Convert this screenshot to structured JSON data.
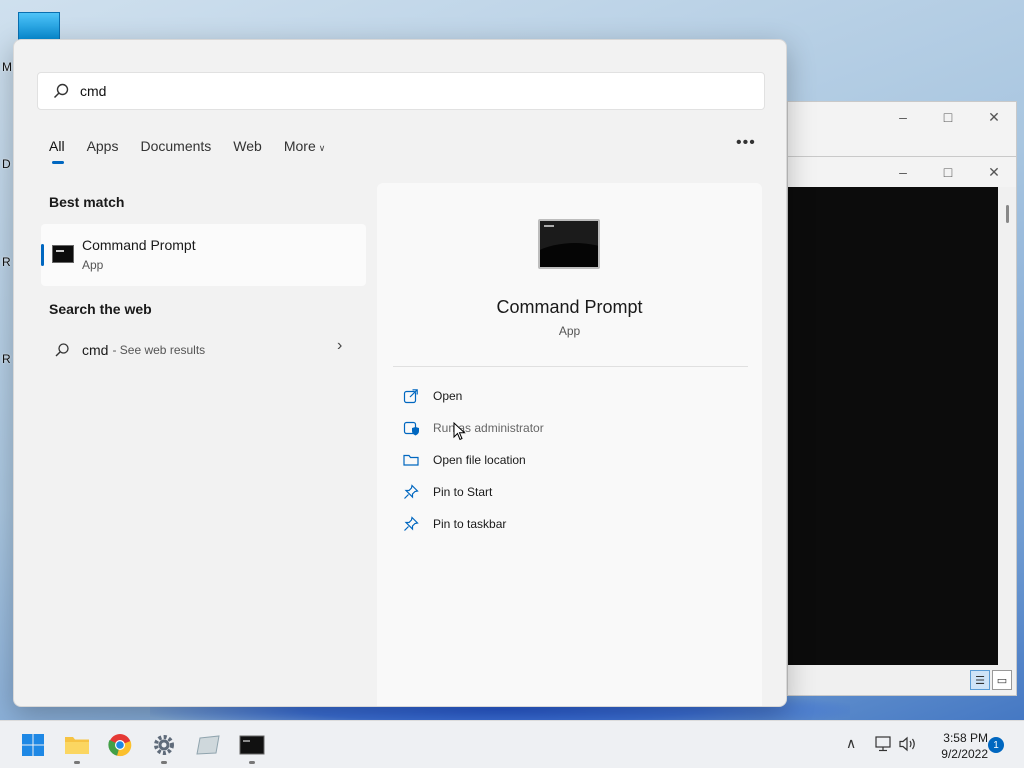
{
  "desktop": {
    "icon_letters": [
      "M",
      "D",
      "R",
      "R"
    ]
  },
  "search": {
    "query": "cmd"
  },
  "tabs": [
    {
      "label": "All",
      "active": true
    },
    {
      "label": "Apps"
    },
    {
      "label": "Documents"
    },
    {
      "label": "Web"
    },
    {
      "label": "More"
    }
  ],
  "best_match": {
    "heading": "Best match",
    "name": "Command Prompt",
    "type": "App"
  },
  "web_section": {
    "heading": "Search the web",
    "query": "cmd",
    "suffix": "- See web results"
  },
  "detail": {
    "name": "Command Prompt",
    "type": "App",
    "actions": [
      {
        "label": "Open",
        "icon": "open-external-icon"
      },
      {
        "label": "Run as administrator",
        "icon": "shield-admin-icon"
      },
      {
        "label": "Open file location",
        "icon": "folder-icon"
      },
      {
        "label": "Pin to Start",
        "icon": "pin-icon"
      },
      {
        "label": "Pin to taskbar",
        "icon": "pin-icon"
      }
    ]
  },
  "taskbar": {
    "apps": [
      "start-icon",
      "file-explorer-icon",
      "chrome-icon",
      "settings-icon",
      "whiteboard-icon",
      "command-prompt-icon"
    ],
    "time": "3:58 PM",
    "date": "9/2/2022",
    "notification_count": "1"
  },
  "colors": {
    "accent": "#0067c0",
    "panel_bg": "#f2f2f2",
    "console_bg": "#0c0c0c"
  }
}
